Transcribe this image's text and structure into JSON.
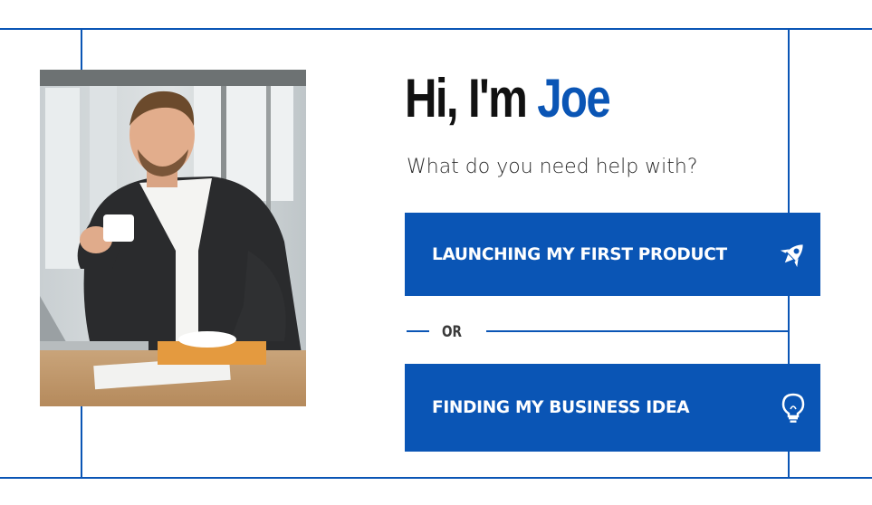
{
  "hero": {
    "greeting": "Hi, I'm ",
    "name": "Joe",
    "question": "What do you need help with?"
  },
  "options": [
    {
      "label": "LAUNCHING MY FIRST PRODUCT",
      "icon": "rocket-icon"
    },
    {
      "label": "FINDING MY BUSINESS IDEA",
      "icon": "lightbulb-icon"
    }
  ],
  "divider": {
    "text": "OR"
  },
  "colors": {
    "accent": "#0a55b5",
    "text": "#111111",
    "background": "#ffffff"
  }
}
